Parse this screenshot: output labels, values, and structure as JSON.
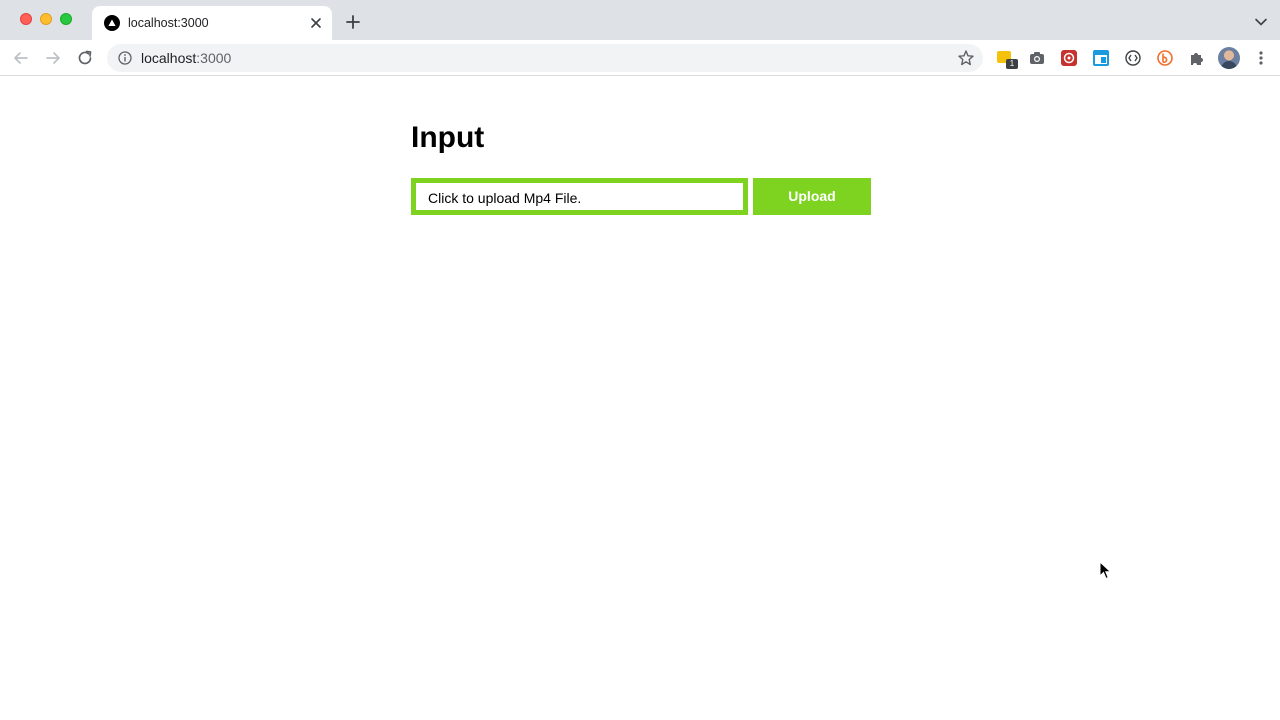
{
  "browser": {
    "tab": {
      "title": "localhost:3000"
    },
    "address_bar": {
      "host": "localhost",
      "port": ":3000"
    },
    "extensions": {
      "notes_badge": "1"
    }
  },
  "page": {
    "heading": "Input",
    "file_input": {
      "label": "Click to upload Mp4 File."
    },
    "upload_button": {
      "label": "Upload"
    }
  },
  "colors": {
    "accent_green": "#7ed321",
    "tabstrip": "#dee1e6",
    "omnibox": "#f1f3f4"
  }
}
